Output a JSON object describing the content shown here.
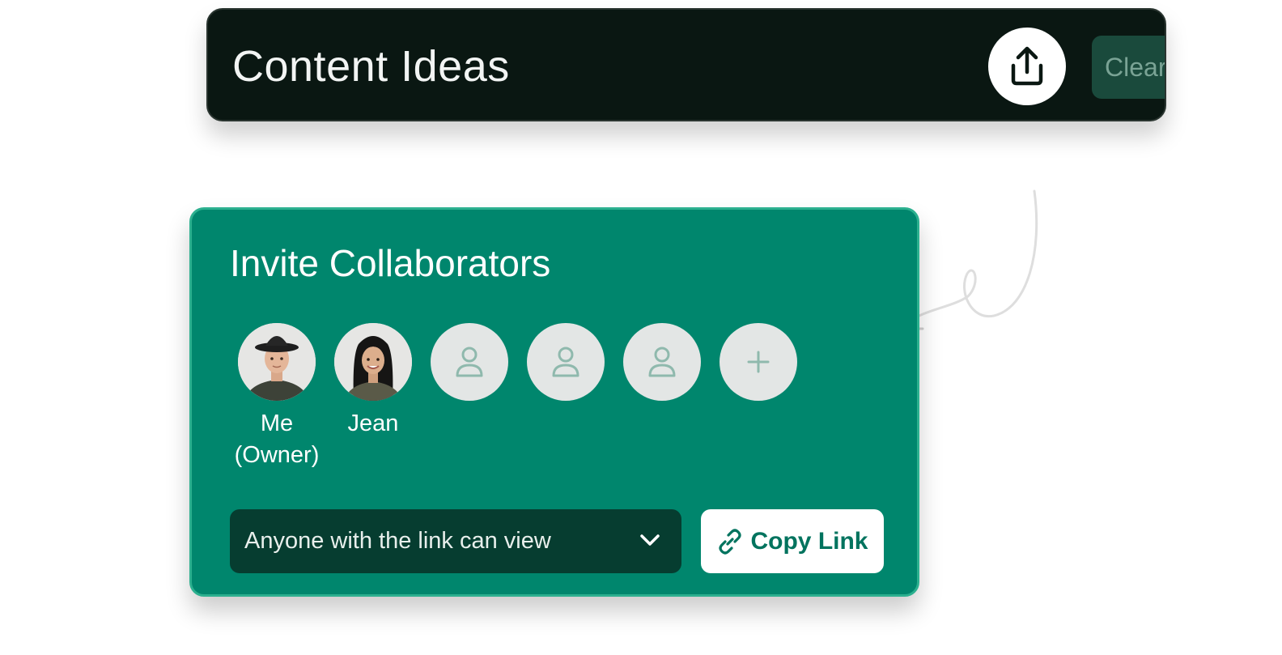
{
  "colors": {
    "header_bg": "#0a1712",
    "card_bg": "#00866d",
    "card_border": "#2cb08f",
    "select_bg": "#063d30",
    "copy_text": "#00735e",
    "avatar_placeholder": "#e3e6e5",
    "placeholder_icon": "#8fb9ad"
  },
  "header": {
    "title": "Content Ideas",
    "share_icon": "share-upload-icon",
    "clear_label": "Clear"
  },
  "invite": {
    "title": "Invite Collaborators",
    "collaborators": [
      {
        "label": "Me (Owner)",
        "label_lines": [
          "Me",
          "(Owner)"
        ],
        "icon": "avatar-photo-owner"
      },
      {
        "label": "Jean",
        "icon": "avatar-photo-jean"
      }
    ],
    "empty_slots": [
      {
        "icon": "person-icon"
      },
      {
        "icon": "person-icon"
      },
      {
        "icon": "person-icon"
      }
    ],
    "add_icon": "plus-icon",
    "access_select": {
      "value": "Anyone with the link can view",
      "icon": "chevron-down-icon"
    },
    "copy_button": {
      "label": "Copy Link",
      "icon": "link-icon"
    }
  }
}
